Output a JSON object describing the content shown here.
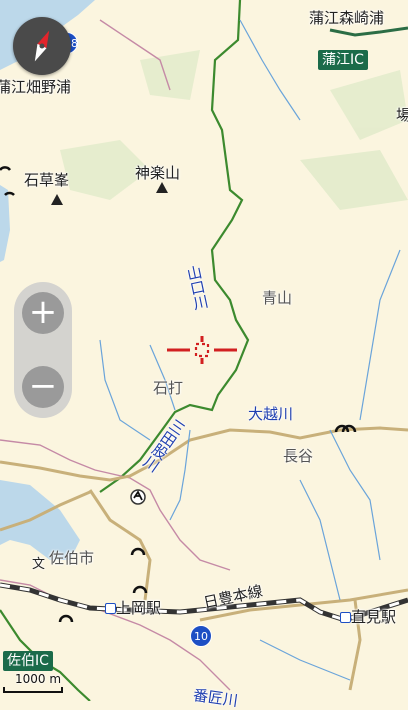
{
  "map": {
    "places": {
      "kamae_morizakiura": "蒲江森崎浦",
      "kamae_hatanoura": "蒲江畑野浦",
      "kokusou_mine": "石草峯",
      "kagura_yama": "神楽山",
      "aoyama": "青山",
      "ishiuchi": "石打",
      "nagatani": "長谷",
      "saiki_city": "佐伯市",
      "ba_partial": "場"
    },
    "rivers": {
      "yamaguchi_river": "山口川",
      "mita_river": "三田股川",
      "ookoshi_river": "大越川",
      "bottom_partial": "番匠川"
    },
    "interchanges": {
      "kamae_ic": "蒲江IC",
      "saiki_ic": "佐伯IC"
    },
    "stations": {
      "kamioka": "上岡駅",
      "chokumi": "直見駅"
    },
    "railway": "日豊本線",
    "route_shields": {
      "r388": "388",
      "r10": "10"
    },
    "misc_marker": "文"
  },
  "controls": {
    "zoom_in": "+",
    "zoom_out": "−",
    "scale": "1000 m"
  },
  "colors": {
    "background": "#fbf5df",
    "river": "#1f3fb0",
    "boundary": "#3c8a2e",
    "railway": "#333333",
    "ic_badge": "#1b6b4a",
    "crosshair": "#d22020"
  }
}
